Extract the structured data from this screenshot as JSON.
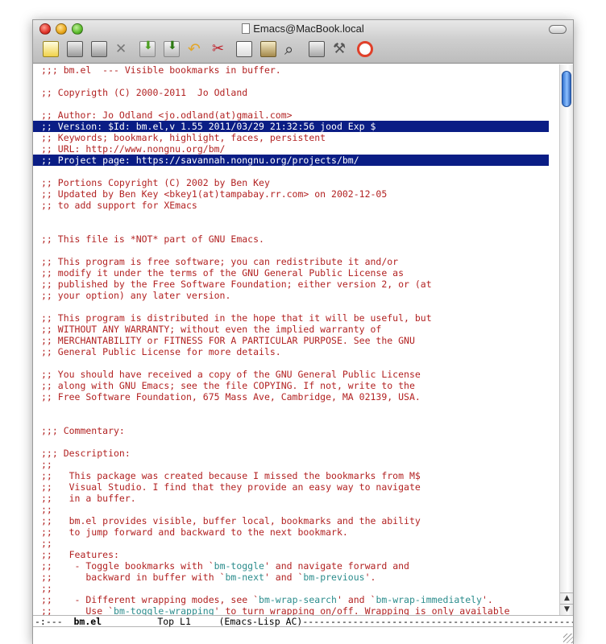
{
  "window": {
    "title": "Emacs@MacBook.local"
  },
  "toolbar": {
    "icons": [
      {
        "name": "new-file-icon"
      },
      {
        "name": "open-dir-icon"
      },
      {
        "name": "save-icon"
      },
      {
        "name": "close-icon"
      },
      {
        "name": "save-as-icon"
      },
      {
        "name": "insert-file-icon"
      },
      {
        "name": "undo-icon"
      },
      {
        "name": "cut-icon"
      },
      {
        "name": "copy-icon"
      },
      {
        "name": "paste-icon"
      },
      {
        "name": "search-icon"
      },
      {
        "name": "print-icon"
      },
      {
        "name": "preferences-icon"
      },
      {
        "name": "help-icon"
      }
    ]
  },
  "buffer": {
    "lines": [
      {
        "text": ";;; bm.el  --- Visible bookmarks in buffer."
      },
      {
        "text": ""
      },
      {
        "text": ";; Copyrigth (C) 2000-2011  Jo Odland"
      },
      {
        "text": ""
      },
      {
        "text": ";; Author: Jo Odland <jo.odland(at)gmail.com>"
      },
      {
        "text": ";; Version: $Id: bm.el,v 1.55 2011/03/29 21:32:56 jood Exp $",
        "hl": true
      },
      {
        "text": ";; Keywords; bookmark, highlight, faces, persistent"
      },
      {
        "text": ";; URL: http://www.nongnu.org/bm/"
      },
      {
        "text": ";; Project page: https://savannah.nongnu.org/projects/bm/",
        "hl": true
      },
      {
        "text": ""
      },
      {
        "text": ";; Portions Copyright (C) 2002 by Ben Key"
      },
      {
        "text": ";; Updated by Ben Key <bkey1(at)tampabay.rr.com> on 2002-12-05"
      },
      {
        "text": ";; to add support for XEmacs"
      },
      {
        "text": ""
      },
      {
        "text": ""
      },
      {
        "text": ";; This file is *NOT* part of GNU Emacs."
      },
      {
        "text": ""
      },
      {
        "text": ";; This program is free software; you can redistribute it and/or"
      },
      {
        "text": ";; modify it under the terms of the GNU General Public License as"
      },
      {
        "text": ";; published by the Free Software Foundation; either version 2, or (at"
      },
      {
        "text": ";; your option) any later version."
      },
      {
        "text": ""
      },
      {
        "text": ";; This program is distributed in the hope that it will be useful, but"
      },
      {
        "text": ";; WITHOUT ANY WARRANTY; without even the implied warranty of"
      },
      {
        "text": ";; MERCHANTABILITY or FITNESS FOR A PARTICULAR PURPOSE. See the GNU"
      },
      {
        "text": ";; General Public License for more details."
      },
      {
        "text": ""
      },
      {
        "text": ";; You should have received a copy of the GNU General Public License"
      },
      {
        "text": ";; along with GNU Emacs; see the file COPYING. If not, write to the"
      },
      {
        "text": ";; Free Software Foundation, 675 Mass Ave, Cambridge, MA 02139, USA."
      },
      {
        "text": ""
      },
      {
        "text": ""
      },
      {
        "text": ";;; Commentary:"
      },
      {
        "text": ""
      },
      {
        "text": ";;; Description:"
      },
      {
        "text": ";;"
      },
      {
        "text": ";;   This package was created because I missed the bookmarks from M$"
      },
      {
        "text": ";;   Visual Studio. I find that they provide an easy way to navigate"
      },
      {
        "text": ";;   in a buffer."
      },
      {
        "text": ";;"
      },
      {
        "text": ";;   bm.el provides visible, buffer local, bookmarks and the ability"
      },
      {
        "text": ";;   to jump forward and backward to the next bookmark."
      },
      {
        "text": ";;"
      },
      {
        "text": ";;   Features:"
      },
      {
        "segments": [
          ";;    - Toggle bookmarks with `",
          {
            "fn": "bm-toggle"
          },
          "' and navigate forward and"
        ]
      },
      {
        "segments": [
          ";;      backward in buffer with `",
          {
            "fn": "bm-next"
          },
          "' and `",
          {
            "fn": "bm-previous"
          },
          "'."
        ]
      },
      {
        "text": ";;"
      },
      {
        "segments": [
          ";;    - Different wrapping modes, see `",
          {
            "fn": "bm-wrap-search"
          },
          "' and `",
          {
            "fn": "bm-wrap-immediately"
          },
          "'."
        ]
      },
      {
        "segments": [
          ";;      Use `",
          {
            "fn": "bm-toggle-wrapping"
          },
          "' to turn wrapping on/off. Wrapping is only available"
        ]
      }
    ]
  },
  "modeline": {
    "status": "-:---  ",
    "buffer_name": "bm.el",
    "position": "          Top L1     ",
    "mode": "(Emacs-Lisp AC)",
    "fill": "-----------------------------------------------------------------------------"
  },
  "colors": {
    "comment": "#b22222",
    "highlight_bg": "#0a1d85",
    "function_ref": "#2b8c8c"
  }
}
